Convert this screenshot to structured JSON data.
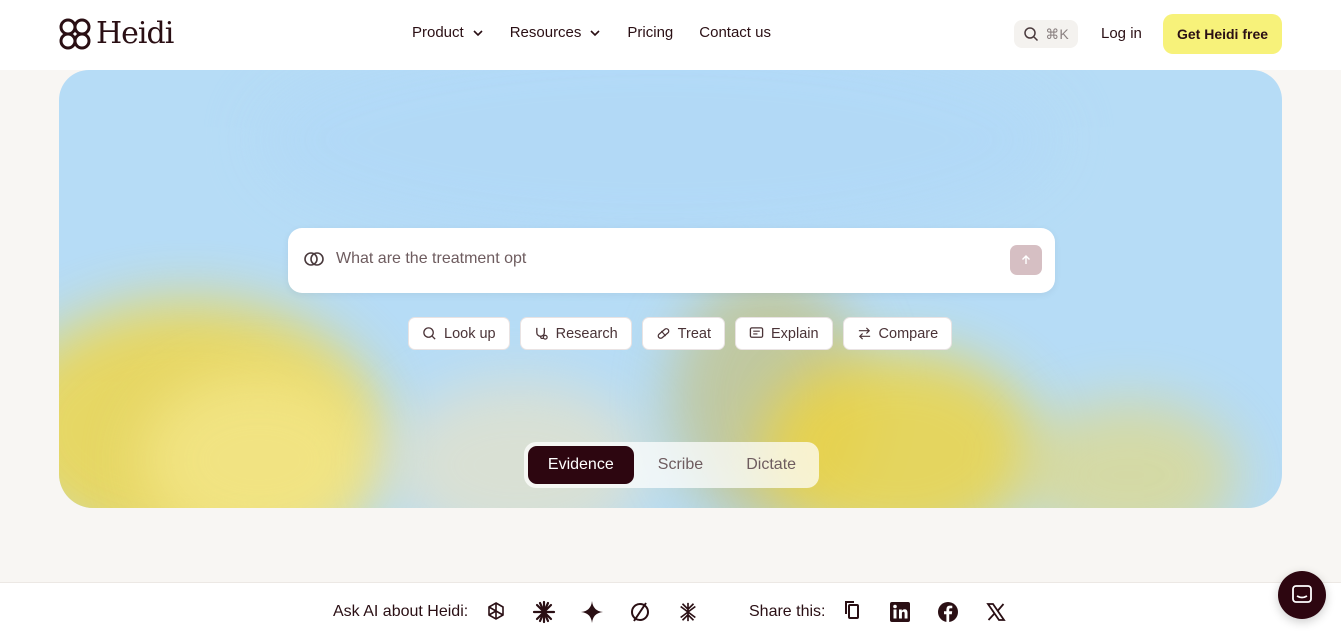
{
  "brand": {
    "name": "Heidi"
  },
  "nav": {
    "items": [
      {
        "label": "Product",
        "has_dropdown": true
      },
      {
        "label": "Resources",
        "has_dropdown": true
      },
      {
        "label": "Pricing",
        "has_dropdown": false
      },
      {
        "label": "Contact us",
        "has_dropdown": false
      }
    ],
    "search_shortcut": "⌘K",
    "login_label": "Log in",
    "cta_label": "Get Heidi free"
  },
  "hero": {
    "search_value": "What are the treatment opt",
    "chips": [
      {
        "label": "Look up",
        "icon": "search-icon"
      },
      {
        "label": "Research",
        "icon": "stethoscope-icon"
      },
      {
        "label": "Treat",
        "icon": "pill-icon"
      },
      {
        "label": "Explain",
        "icon": "message-icon"
      },
      {
        "label": "Compare",
        "icon": "swap-icon"
      }
    ],
    "modes": [
      {
        "label": "Evidence",
        "active": true
      },
      {
        "label": "Scribe",
        "active": false
      },
      {
        "label": "Dictate",
        "active": false
      }
    ]
  },
  "footer": {
    "ask_label": "Ask AI about Heidi:",
    "ai_icons": [
      "openai-icon",
      "claude-icon",
      "gemini-icon",
      "perplexity-icon",
      "grok-icon"
    ],
    "share_label": "Share this:",
    "share_icons": [
      "copy-icon",
      "linkedin-icon",
      "facebook-icon",
      "x-icon"
    ]
  },
  "colors": {
    "accent": "#f7f27a",
    "dark": "#2d0610",
    "hero_sky": "#b6dcf6",
    "hero_flower": "#f0d84a"
  }
}
